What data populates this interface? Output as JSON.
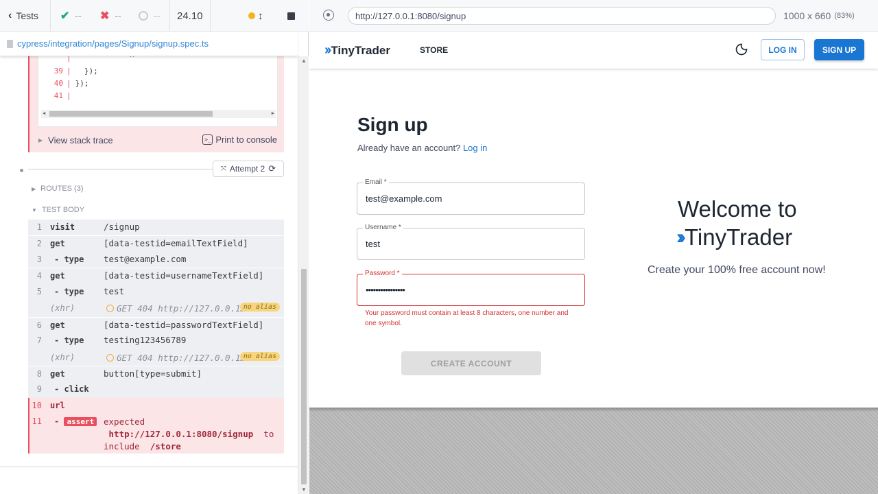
{
  "runner": {
    "tests_label": "Tests",
    "passed": "--",
    "failed": "--",
    "pending": "--",
    "duration": "24.10",
    "spec_path": "cypress/integration/pages/Signup/signup.spec.ts",
    "code_lines": [
      {
        "n": "",
        "text": "            ^"
      },
      {
        "n": "39",
        "text": "  });"
      },
      {
        "n": "40",
        "text": "});"
      },
      {
        "n": "41",
        "text": ""
      }
    ],
    "view_stack_trace": "View stack trace",
    "print_to_console": "Print to console",
    "attempt_label": "Attempt 2",
    "routes_label": "ROUTES (3)",
    "test_body_label": "TEST BODY",
    "commands": [
      {
        "num": "1",
        "name": "visit",
        "msg": "/signup"
      },
      {
        "num": "2",
        "name": "get",
        "msg": "[data-testid=emailTextField]"
      },
      {
        "num": "3",
        "name": "- type",
        "msg": "test@example.com"
      },
      {
        "num": "4",
        "name": "get",
        "msg": "[data-testid=usernameTextField]"
      },
      {
        "num": "5",
        "name": "- type",
        "msg": "test"
      },
      {
        "num": "",
        "name": "(xhr)",
        "msg": "GET 404 http://127.0.0.1…",
        "alias": "no alias"
      },
      {
        "num": "6",
        "name": "get",
        "msg": "[data-testid=passwordTextField]"
      },
      {
        "num": "7",
        "name": "- type",
        "msg": "testing123456789"
      },
      {
        "num": "",
        "name": "(xhr)",
        "msg": "GET 404 http://127.0.0.1…",
        "alias": "no alias"
      },
      {
        "num": "8",
        "name": "get",
        "msg": "button[type=submit]"
      },
      {
        "num": "9",
        "name": "- click",
        "msg": ""
      },
      {
        "num": "10",
        "name": "url",
        "msg": ""
      },
      {
        "num": "11",
        "name": "assert",
        "msg_parts": [
          "expected",
          "http://127.0.0.1:8080/signup",
          "to",
          "include",
          "/store"
        ]
      }
    ]
  },
  "browser": {
    "url": "http://127.0.0.1:8080/signup",
    "viewport": "1000 x 660",
    "zoom": "(83%)"
  },
  "app": {
    "brand": "TinyTrader",
    "nav_store": "STORE",
    "login": "LOG IN",
    "signup": "SIGN UP",
    "title": "Sign up",
    "have_account": "Already have an account?",
    "login_link": "Log in",
    "email_label": "Email *",
    "email_value": "test@example.com",
    "username_label": "Username *",
    "username_value": "test",
    "password_label": "Password *",
    "password_value": "••••••••••••••••",
    "password_error": "Your password must contain at least 8 characters, one number and one symbol.",
    "create_account": "CREATE ACCOUNT",
    "welcome_line1": "Welcome to",
    "welcome_line2": "TinyTrader",
    "welcome_sub": "Create your 100% free account now!"
  },
  "colors": {
    "accent": "#1976d2",
    "error": "#d32f2f",
    "runner_error": "#e94f5f"
  }
}
